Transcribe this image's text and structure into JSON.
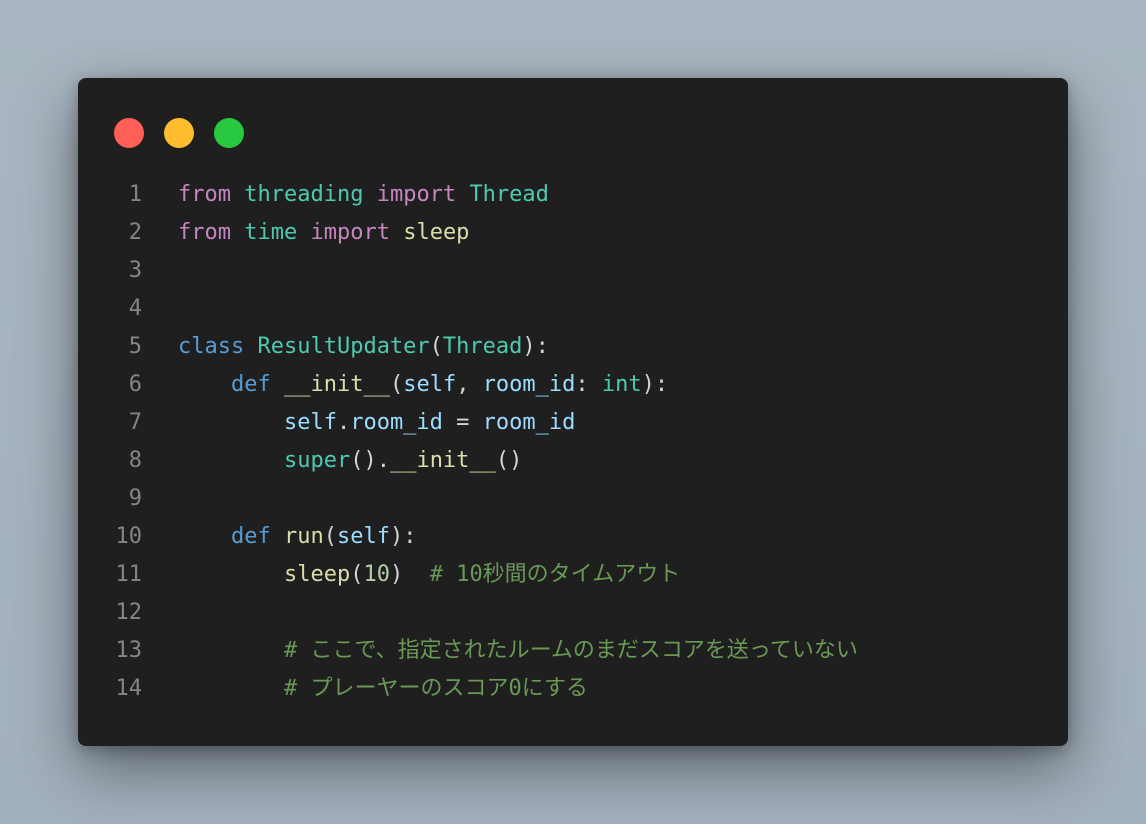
{
  "window": {
    "controls": [
      {
        "name": "close",
        "color": "#ff5f57"
      },
      {
        "name": "minimize",
        "color": "#febc2e"
      },
      {
        "name": "maximize",
        "color": "#28c840"
      }
    ]
  },
  "colors": {
    "background": "#1f1f1f",
    "line_number": "#858585",
    "keyword": "#c586c0",
    "module": "#4ec9b0",
    "def_keyword": "#569cd6",
    "function": "#dcdcaa",
    "variable": "#9cdcfe",
    "number": "#b5cea8",
    "comment": "#6a9955",
    "default": "#d4d4d4"
  },
  "code": {
    "lines": [
      {
        "num": "1",
        "tokens": [
          [
            "kw",
            "from"
          ],
          [
            "",
            ""
          ],
          [
            "",
            ""
          ]
        ]
      },
      {
        "num": "2"
      },
      {
        "num": "3"
      },
      {
        "num": "4"
      },
      {
        "num": "5"
      },
      {
        "num": "6"
      },
      {
        "num": "7"
      },
      {
        "num": "8"
      },
      {
        "num": "9"
      },
      {
        "num": "10"
      },
      {
        "num": "11"
      },
      {
        "num": "12"
      },
      {
        "num": "13"
      },
      {
        "num": "14"
      }
    ],
    "text": {
      "l1": [
        "from",
        " ",
        "threading",
        " ",
        "import",
        " ",
        "Thread"
      ],
      "l2": [
        "from",
        " ",
        "time",
        " ",
        "import",
        " ",
        "sleep"
      ],
      "l5": [
        "class",
        " ",
        "ResultUpdater",
        "(",
        "Thread",
        "):"
      ],
      "l6": [
        "    ",
        "def",
        " ",
        "__init__",
        "(",
        "self",
        ", ",
        "room_id",
        ": ",
        "int",
        "):"
      ],
      "l7": [
        "        ",
        "self",
        ".",
        "room_id",
        " = ",
        "room_id"
      ],
      "l8": [
        "        ",
        "super",
        "().",
        "__init__",
        "()"
      ],
      "l10": [
        "    ",
        "def",
        " ",
        "run",
        "(",
        "self",
        "):"
      ],
      "l11": [
        "        ",
        "sleep",
        "(",
        "10",
        ")  ",
        "# 10秒間のタイムアウト"
      ],
      "l13": [
        "        ",
        "# ここで、指定されたルームのまだスコアを送っていない"
      ],
      "l14": [
        "        ",
        "# プレーヤーのスコア0にする"
      ]
    }
  }
}
